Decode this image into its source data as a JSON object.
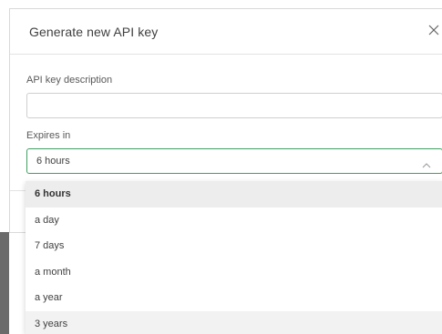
{
  "modal": {
    "title": "Generate new API key",
    "close_icon": "close-icon"
  },
  "form": {
    "description_label": "API key description",
    "description_value": "",
    "description_placeholder": "",
    "expires_label": "Expires in",
    "expires_selected": "6 hours",
    "expires_icon": "chevron-up-icon"
  },
  "dropdown": {
    "options": [
      "6 hours",
      "a day",
      "7 days",
      "a month",
      "a year",
      "3 years"
    ],
    "selected_option": "6 hours",
    "hovered_option": "3 years"
  },
  "colors": {
    "focus_border": "#40a060",
    "selected_bg": "#ededed",
    "backdrop": "#6b6b6b"
  }
}
